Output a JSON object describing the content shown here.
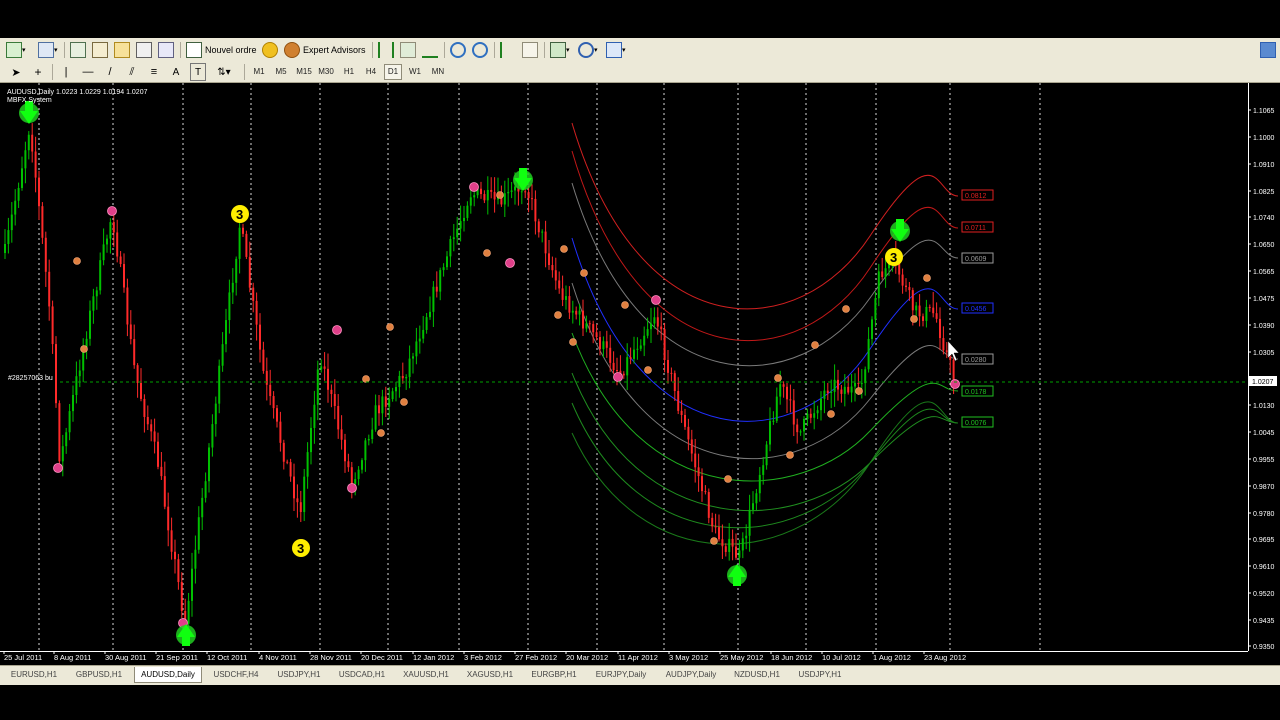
{
  "toolbar": {
    "new_order_label": "Nouvel ordre",
    "expert_advisors_label": "Expert Advisors"
  },
  "timeframes": [
    "M1",
    "M5",
    "M15",
    "M30",
    "H1",
    "H4",
    "D1",
    "W1",
    "MN"
  ],
  "active_timeframe": "D1",
  "chart": {
    "symbol_line": "AUDUSD,Daily  1.0223 1.0229 1.0194 1.0207",
    "indicator_name": "MBFX System",
    "order_label": "#28257063 bu",
    "current_price": "1.0207",
    "price_ticks": [
      "1.1065",
      "1.1000",
      "1.0910",
      "1.0825",
      "1.0740",
      "1.0650",
      "1.0565",
      "1.0475",
      "1.0390",
      "1.0305",
      "1.0130",
      "1.0045",
      "0.9955",
      "0.9870",
      "0.9780",
      "0.9695",
      "0.9610",
      "0.9520",
      "0.9435",
      "0.9350"
    ],
    "date_ticks": [
      "25 Jul 2011",
      "8 Aug 2011",
      "30 Aug 2011",
      "21 Sep 2011",
      "12 Oct 2011",
      "4 Nov 2011",
      "28 Nov 2011",
      "20 Dec 2011",
      "12 Jan 2012",
      "3 Feb 2012",
      "27 Feb 2012",
      "20 Mar 2012",
      "11 Apr 2012",
      "3 May 2012",
      "25 May 2012",
      "18 Jun 2012",
      "10 Jul 2012",
      "1 Aug 2012",
      "23 Aug 2012"
    ],
    "band_labels": [
      {
        "text": "0.0812",
        "color": "#e02020"
      },
      {
        "text": "0.0711",
        "color": "#e02020"
      },
      {
        "text": "0.0609",
        "color": "#9a9a9a"
      },
      {
        "text": "0.0456",
        "color": "#2030ff"
      },
      {
        "text": "0.0280",
        "color": "#9a9a9a"
      },
      {
        "text": "0.0178",
        "color": "#20c020"
      },
      {
        "text": "0.0076",
        "color": "#20c020"
      }
    ],
    "signal_markers": [
      "3",
      "3",
      "3"
    ]
  },
  "tabs": [
    "EURUSD,H1",
    "GBPUSD,H1",
    "AUDUSD,Daily",
    "USDCHF,H4",
    "USDJPY,H1",
    "USDCAD,H1",
    "XAUUSD,H1",
    "XAGUSD,H1",
    "EURGBP,H1",
    "EURJPY,Daily",
    "AUDJPY,Daily",
    "NZDUSD,H1",
    "USDJPY,H1"
  ],
  "active_tab": "AUDUSD,Daily",
  "colors": {
    "bull_candle": "#00c000",
    "bear_candle": "#ff2a2a",
    "grid": "#ffffff",
    "signal_arrow": "#22cc22",
    "signal_badge": "#ffee00",
    "swing_dot_high": "#e0408a",
    "swing_dot_low": "#e08040"
  }
}
